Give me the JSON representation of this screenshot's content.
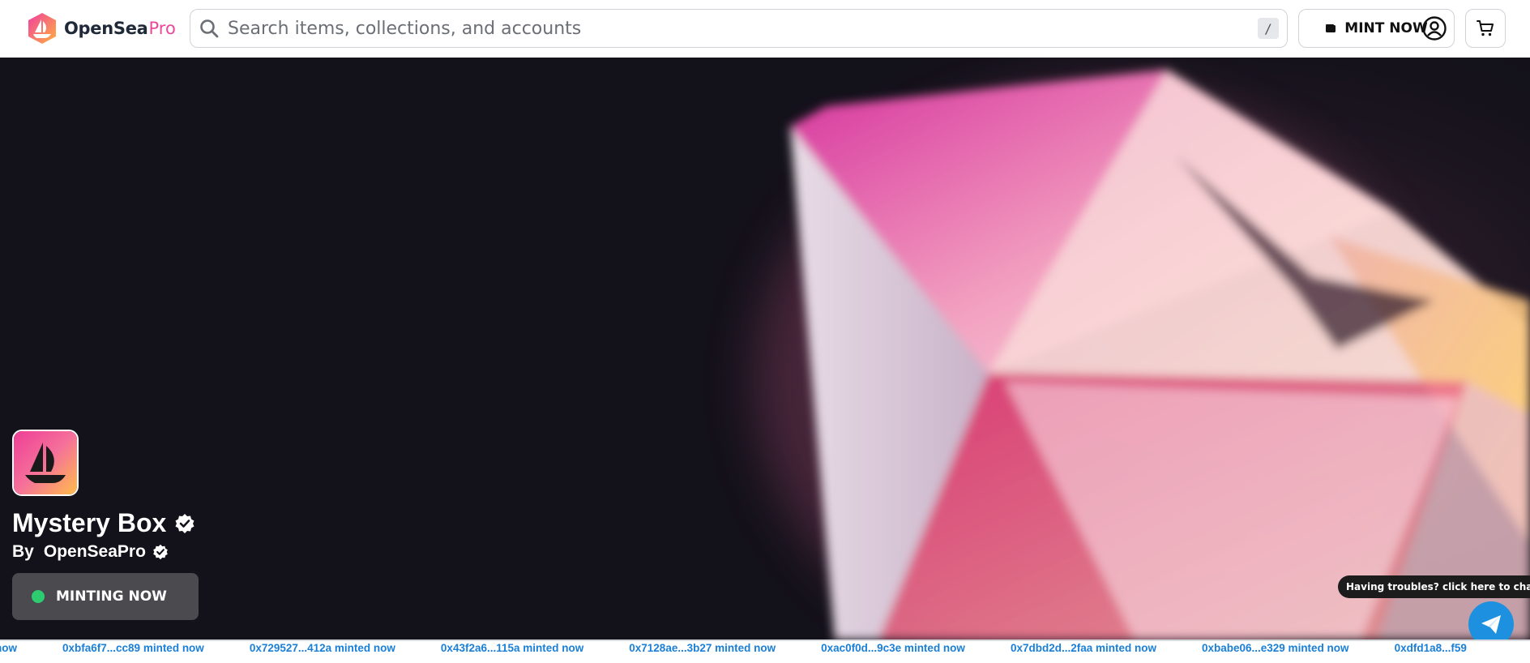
{
  "header": {
    "logo_text": "OpenSea",
    "logo_suffix": "Pro",
    "search_placeholder": "Search items, collections, and accounts",
    "search_shortcut": "/",
    "mint_label": "MINT NOW"
  },
  "collection": {
    "name": "Mystery Box",
    "by_label": "By",
    "creator": "OpenSeaPro",
    "status": "MINTING NOW",
    "status_color": "#2ecc71"
  },
  "chat": {
    "tooltip": "Having troubles? click here to chat"
  },
  "ticker": {
    "items": [
      "now",
      "0xbfa6f7...cc89 minted now",
      "0x729527...412a minted now",
      "0x43f2a6...115a minted now",
      "0x7128ae...3b27 minted now",
      "0xac0f0d...9c3e minted now",
      "0x7dbd2d...2faa minted now",
      "0xbabe06...e329 minted now",
      "0xdfd1a8...f59"
    ]
  },
  "colors": {
    "accent": "#ec4899",
    "ticker_text": "#1a7fd6",
    "hero_bg": "#13111a",
    "chat_fab": "#1e90e0"
  },
  "icons": {
    "search": "search-icon",
    "wallet": "wallet-icon",
    "profile": "profile-icon",
    "cart": "cart-icon",
    "verified": "verified-badge-icon",
    "send": "send-icon"
  }
}
